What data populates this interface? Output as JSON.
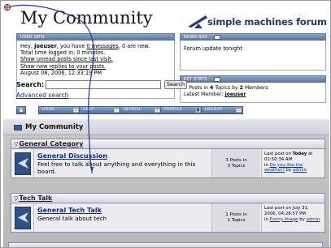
{
  "forum": {
    "title": "My Community",
    "logo_text": "simple machines forum"
  },
  "user_info": {
    "header": "USER INFO",
    "line1_prefix": "Hey, ",
    "username": "joeuser",
    "line1_mid": ", you have ",
    "messages_link": "0 messages",
    "line1_suffix": ", 0 are new.",
    "time_logged": "Total time logged in: 0 minutes.",
    "unread_posts_link": "Show unread posts since last visit.",
    "new_replies_link": "Show new replies to your posts.",
    "datetime": "August 08, 2006, 12:33:19 PM"
  },
  "news_box": {
    "header": "NEWS BOX",
    "text": "Forum update tonight"
  },
  "key_stats": {
    "header": "KEY STATS",
    "posts": "4",
    "posts_label": " Posts in ",
    "topics": "4",
    "topics_label": " Topics by ",
    "members": "2",
    "members_label": " Members",
    "latest_label": "Latest Member: ",
    "latest_member": "joeuser"
  },
  "search": {
    "label": "Search:",
    "value": "",
    "button": "Search",
    "advanced_link": "Advanced search"
  },
  "menu": {
    "items": [
      {
        "label": "HOME",
        "icon": "home-icon"
      },
      {
        "label": "HELP",
        "icon": "help-icon"
      },
      {
        "label": "SEARCH",
        "icon": "search-icon"
      },
      {
        "label": "PROFILE",
        "icon": "profile-icon"
      },
      {
        "label": "LOGOUT",
        "icon": "logout-icon"
      }
    ]
  },
  "board_index": {
    "title": "My Community",
    "categories": [
      {
        "name": "General Category",
        "board": {
          "name": "General Discussion",
          "description": "Feel free to talk about anything and everything in this board.",
          "posts": "3 Posts in",
          "topics": "3 Topics",
          "last_prefix": "Last post on ",
          "last_date_bold": "Today",
          "last_time": " at 01:50:34 AM",
          "last_in": "in ",
          "last_topic": "Do you like the weather?",
          "last_by": " by ",
          "last_author": "admin"
        }
      },
      {
        "name": "Tech Talk",
        "board": {
          "name": "General Tech Talk",
          "description": "General talk about tech",
          "posts": "1 Posts in",
          "topics": "1 Topics",
          "last_prefix": "Last post on ",
          "last_date_bold": "",
          "last_time": "July 31, 2006, 04:28:57 PM",
          "last_in": "in ",
          "last_topic": "Funny Image",
          "last_by": " by ",
          "last_author": "admin"
        }
      }
    ]
  },
  "colors": {
    "panel_header": "#5b7aa8",
    "link": "#0b2d86",
    "cursor_path": "#1f3aa8"
  }
}
